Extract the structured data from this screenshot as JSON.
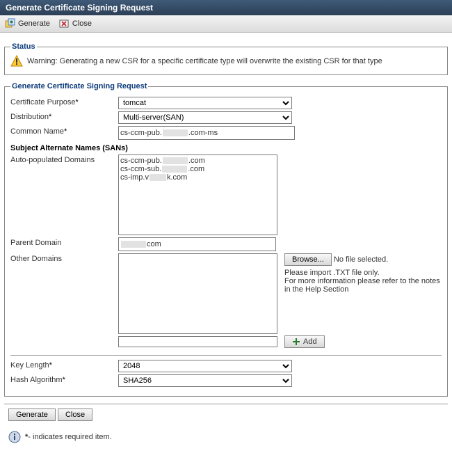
{
  "window": {
    "title": "Generate Certificate Signing Request"
  },
  "toolbar": {
    "generate_label": "Generate",
    "close_label": "Close"
  },
  "status": {
    "legend": "Status",
    "warning": "Warning: Generating a new CSR for a specific certificate type will overwrite the existing CSR for that type"
  },
  "form": {
    "legend": "Generate Certificate Signing Request",
    "certificate_purpose": {
      "label": "Certificate Purpose",
      "value": "tomcat"
    },
    "distribution": {
      "label": "Distribution",
      "value": "Multi-server(SAN)"
    },
    "common_name": {
      "label": "Common Name",
      "prefix": "cs-ccm-pub.",
      "suffix": ".com-ms"
    },
    "san_heading": "Subject Alternate Names (SANs)",
    "auto_domains": {
      "label": "Auto-populated Domains",
      "lines": [
        {
          "prefix": "cs-ccm-pub.",
          "suffix": ".com"
        },
        {
          "prefix": "cs-ccm-sub.",
          "suffix": ".com"
        },
        {
          "prefix": "cs-imp.v",
          "suffix": "k.com"
        }
      ]
    },
    "parent_domain": {
      "label": "Parent Domain",
      "suffix": "com"
    },
    "other_domains": {
      "label": "Other Domains",
      "browse_label": "Browse...",
      "no_file": "No file selected.",
      "hint1": "Please import .TXT file only.",
      "hint2": "For more information please refer to the notes in the Help Section",
      "add_label": "Add"
    },
    "key_length": {
      "label": "Key Length",
      "value": "2048"
    },
    "hash_algorithm": {
      "label": "Hash Algorithm",
      "value": "SHA256"
    }
  },
  "buttons": {
    "generate": "Generate",
    "close": "Close"
  },
  "footnote": "- indicates required item.",
  "footnote_prefix": "*"
}
